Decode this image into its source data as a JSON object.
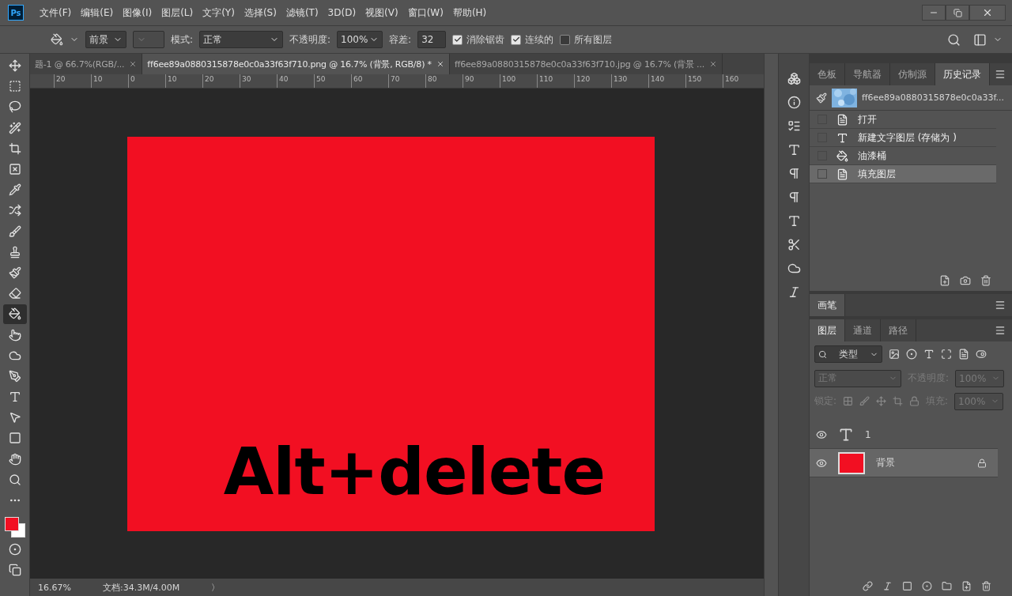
{
  "app": {
    "logo": "Ps"
  },
  "menu": [
    "文件(F)",
    "编辑(E)",
    "图像(I)",
    "图层(L)",
    "文字(Y)",
    "选择(S)",
    "滤镜(T)",
    "3D(D)",
    "视图(V)",
    "窗口(W)",
    "帮助(H)"
  ],
  "options": {
    "fill_source": "前景",
    "mode_label": "模式:",
    "mode": "正常",
    "opacity_label": "不透明度:",
    "opacity": "100%",
    "tolerance_label": "容差:",
    "tolerance": "32",
    "checks": [
      {
        "label": "消除锯齿",
        "checked": true
      },
      {
        "label": "连续的",
        "checked": true
      },
      {
        "label": "所有图层",
        "checked": false
      }
    ]
  },
  "tools": [
    {
      "selected": false
    },
    {
      "selected": false
    },
    {
      "selected": false
    },
    {
      "selected": false
    },
    {
      "selected": false
    },
    {
      "selected": false
    },
    {
      "selected": false
    },
    {
      "selected": false
    },
    {
      "selected": false
    },
    {
      "selected": false
    },
    {
      "selected": false
    },
    {
      "selected": false
    },
    {
      "selected": true
    },
    {
      "selected": false
    },
    {
      "selected": false
    },
    {
      "selected": false
    },
    {
      "selected": false
    },
    {
      "selected": false
    },
    {
      "selected": false
    },
    {
      "selected": false
    },
    {
      "selected": false
    },
    {
      "selected": false
    }
  ],
  "swatches": {
    "foreground": {
      "color": "#f20f22"
    },
    "background": {
      "color": "#ffffff"
    }
  },
  "doc_tabs": [
    {
      "title": "题-1 @ 66.7%(RGB/...",
      "selected": false
    },
    {
      "title": "ff6ee89a0880315878e0c0a33f63f710.png @ 16.7% (背景, RGB/8) *",
      "selected": true
    },
    {
      "title": "ff6ee89a0880315878e0c0a33f63f710.jpg @ 16.7% (背景 ...",
      "selected": false
    }
  ],
  "ruler": [
    "20",
    "10",
    "0",
    "10",
    "20",
    "30",
    "40",
    "50",
    "60",
    "70",
    "80",
    "90",
    "100",
    "110",
    "120",
    "130",
    "140",
    "150",
    "160"
  ],
  "canvas": {
    "text": "Alt+delete"
  },
  "status_bar": {
    "zoom": "16.67%",
    "doc_size": "文档:34.3M/4.00M",
    "arrow": "〉"
  },
  "history_panel": {
    "tabs": [
      {
        "label": "色板",
        "selected": false
      },
      {
        "label": "导航器",
        "selected": false
      },
      {
        "label": "仿制源",
        "selected": false
      },
      {
        "label": "历史记录",
        "selected": true
      }
    ],
    "snapshot": "ff6ee89a0880315878e0c0a33f...",
    "items": [
      {
        "label": "打开",
        "kind": "doc",
        "selected": false
      },
      {
        "label": "新建文字图层 (存储为 )",
        "kind": "text",
        "selected": false
      },
      {
        "label": "油漆桶",
        "kind": "bucket",
        "selected": false
      },
      {
        "label": "填充图层",
        "kind": "doc",
        "selected": true
      }
    ]
  },
  "brush_panel": {
    "tab": "画笔"
  },
  "layers_panel": {
    "tabs": [
      {
        "label": "图层",
        "selected": true
      },
      {
        "label": "通道",
        "selected": false
      },
      {
        "label": "路径",
        "selected": false
      }
    ],
    "filter": "类型",
    "blend": "正常",
    "opacity_label": "不透明度:",
    "opacity": "100%",
    "lock_label": "锁定:",
    "fill_label": "填充:",
    "fill": "100%",
    "layers": [
      {
        "name": "1",
        "kind": "text",
        "visible": true,
        "selected": false,
        "locked": false
      },
      {
        "name": "背景",
        "kind": "fill",
        "visible": true,
        "selected": true,
        "locked": true,
        "color": "#f20f22"
      }
    ]
  }
}
